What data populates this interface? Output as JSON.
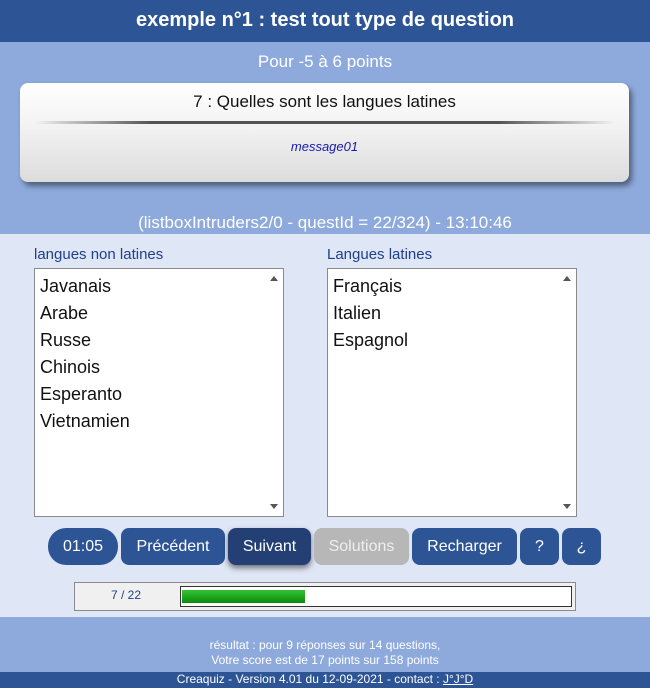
{
  "header": {
    "title": "exemple n°1 : test tout type de question"
  },
  "question": {
    "points": "Pour -5 à 6 points",
    "title": "7 : Quelles sont les langues latines",
    "message": "message01",
    "info": "(listboxIntruders2/0 - questId = 22/324) - 13:10:46"
  },
  "lists": {
    "left": {
      "label": "langues non latines",
      "items": [
        "Javanais",
        "Arabe",
        "Russe",
        "Chinois",
        "Esperanto",
        "Vietnamien"
      ]
    },
    "right": {
      "label": "Langues latines",
      "items": [
        "Français",
        "Italien",
        "Espagnol"
      ]
    }
  },
  "buttons": {
    "timer": "01:05",
    "previous": "Précédent",
    "next": "Suivant",
    "solutions": "Solutions",
    "reload": "Recharger",
    "help": "?",
    "help_inverted": "¿"
  },
  "progress": {
    "label": "7 / 22",
    "current": 7,
    "total": 22
  },
  "result": {
    "line1": "résultat : pour 9 réponses sur 14 questions,",
    "line2": "Votre score est de 17 points sur 158 points"
  },
  "footer": {
    "text": "Creaquiz - Version 4.01 du 12-09-2021 - contact : ",
    "link": "J°J°D"
  },
  "colors": {
    "primary": "#2d5596",
    "secondary": "#8eaadc",
    "background": "#dfe6f5",
    "progress": "#1aa61a"
  }
}
